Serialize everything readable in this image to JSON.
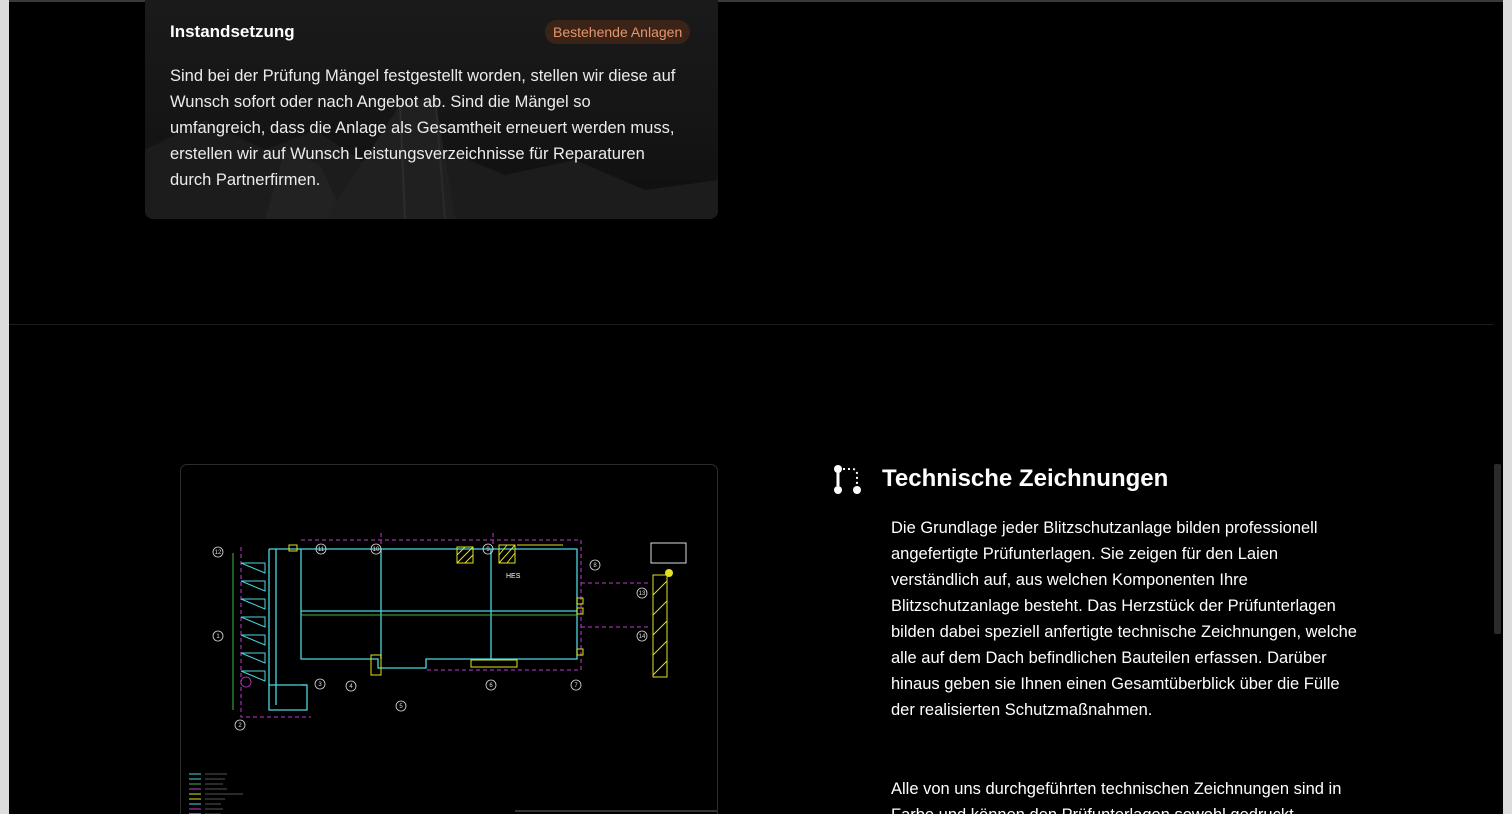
{
  "card": {
    "title": "Instandsetzung",
    "badge": "Bestehende Anlagen",
    "text": "Sind bei der Prüfung Mängel festgestellt worden, stellen wir diese auf Wunsch sofort oder nach Angebot ab. Sind die Mängel so umfangreich, dass die Anlage als Gesamtheit erneuert werden muss, erstellen wir auf Wunsch Leistungsverzeichnisse für Reparaturen durch Partnerfirmen."
  },
  "feature": {
    "icon": "route-icon",
    "title": "Technische Zeichnungen",
    "paragraph1": "Die Grundlage jeder Blitzschutzanlage bilden professionell angefertigte Prüfunterlagen. Sie zeigen für den Laien verständlich auf, aus welchen Komponenten Ihre Blitzschutzanlage besteht. Das Herzstück der Prüfunterlagen bilden dabei speziell anfertigte technische Zeichnungen, welche alle auf dem Dach befindlichen Bauteilen erfassen. Darüber hinaus geben sie Ihnen einen Gesamtüberblick über die Fülle der realisierten Schutzmaßnahmen.",
    "paragraph2": "Alle von uns durchgeführten technischen Zeichnungen sind in Farbe und können den Prüfunterlagen sowohl gedruckt"
  },
  "drawing": {
    "label_hes": "HES",
    "markers": [
      "12",
      "11",
      "10",
      "9",
      "8",
      "13",
      "14",
      "1",
      "3",
      "4",
      "5",
      "6",
      "7",
      "2"
    ]
  },
  "colors": {
    "badge_bg": "#3a2418",
    "badge_text": "#e8956b",
    "drawing_cyan": "#4ad6e0",
    "drawing_magenta": "#c23bd1",
    "drawing_yellow": "#e2e21e"
  }
}
